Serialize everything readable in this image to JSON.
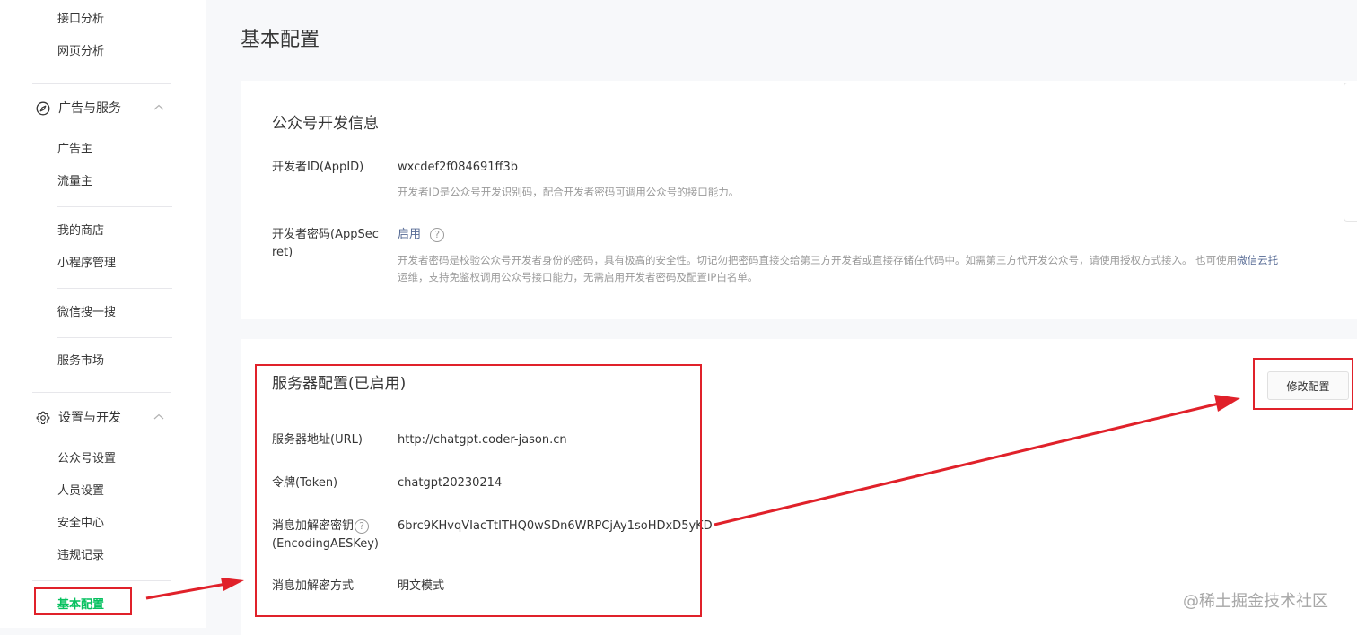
{
  "sidebar": {
    "items_top": [
      "接口分析",
      "网页分析"
    ],
    "group_ads": {
      "label": "广告与服务",
      "icon": "compass-icon",
      "toggle_icon": "chevron-up-icon"
    },
    "ads_items": [
      "广告主",
      "流量主",
      "我的商店",
      "小程序管理",
      "微信搜一搜",
      "服务市场"
    ],
    "group_settings": {
      "label": "设置与开发",
      "icon": "gear-icon",
      "toggle_icon": "chevron-up-icon"
    },
    "settings_items": [
      "公众号设置",
      "人员设置",
      "安全中心",
      "违规记录"
    ],
    "active_item": "基本配置"
  },
  "page": {
    "title": "基本配置"
  },
  "dev_info": {
    "title": "公众号开发信息",
    "appid_label": "开发者ID(AppID)",
    "appid_value": "wxcdef2f084691ff3b",
    "appid_desc": "开发者ID是公众号开发识别码，配合开发者密码可调用公众号的接口能力。",
    "secret_label_line1": "开发者密码(AppSec",
    "secret_label_line2": "ret)",
    "secret_status": "启用",
    "secret_desc_line1": "开发者密码是校验公众号开发者身份的密码，具有极高的安全性。切记勿把密码直接交给第三方开发者或直接存储在代码中。如需第三方代开发公众号，请使用授权方式接入。 也可使用",
    "secret_desc_link": "微信云托",
    "secret_desc_line2": "运维，支持免鉴权调用公众号接口能力，无需启用开发者密码及配置IP白名单。"
  },
  "server_config": {
    "title": "服务器配置(已启用)",
    "modify_button": "修改配置",
    "url_label": "服务器地址(URL)",
    "url_value": "http://chatgpt.coder-jason.cn",
    "token_label": "令牌(Token)",
    "token_value": "chatgpt20230214",
    "aes_label_line1": "消息加解密密钥",
    "aes_label_line2": "(EncodingAESKey)",
    "aes_value": "6brc9KHvqVIacTtITHQ0wSDn6WRPCjAy1soHDxD5yKD",
    "mode_label": "消息加解密方式",
    "mode_value": "明文模式"
  },
  "help_icon_text": "?",
  "annotation_color": "#e0212a",
  "accent_color": "#07c160",
  "watermark": "@稀土掘金技术社区"
}
